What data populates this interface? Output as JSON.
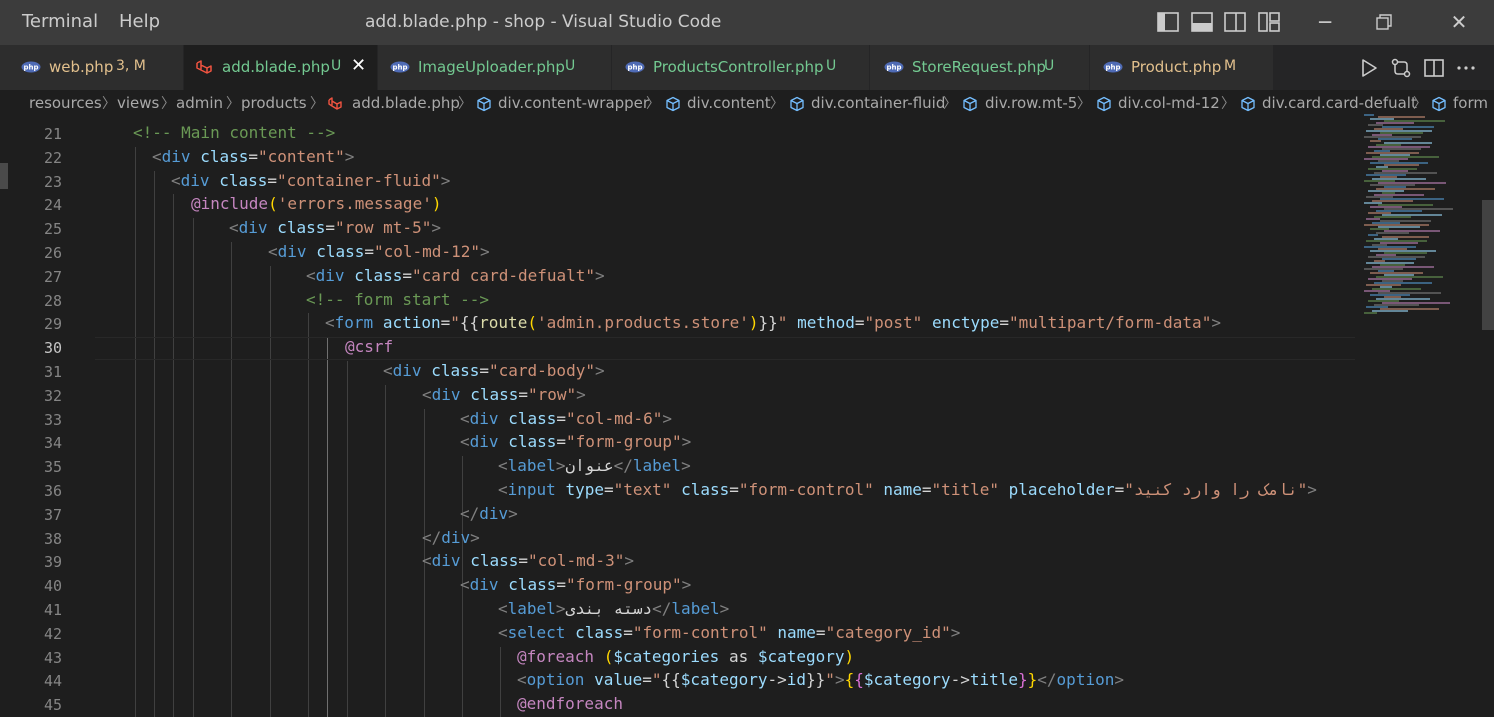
{
  "titlebar": {
    "menus": [
      "Terminal",
      "Help"
    ],
    "window_title": "add.blade.php - shop - Visual Studio Code"
  },
  "tabs": [
    {
      "icon": "php-icon",
      "name": "web.php",
      "status": "3, M",
      "name_color": "#e2c08d",
      "status_color": "#e2c08d",
      "active": false
    },
    {
      "icon": "laravel-icon",
      "name": "add.blade.php",
      "status": "U",
      "name_color": "#73c991",
      "status_color": "#73c991",
      "active": true
    },
    {
      "icon": "php-icon",
      "name": "ImageUploader.php",
      "status": "U",
      "name_color": "#73c991",
      "status_color": "#73c991",
      "active": false
    },
    {
      "icon": "php-icon",
      "name": "ProductsController.php",
      "status": "U",
      "name_color": "#73c991",
      "status_color": "#73c991",
      "active": false
    },
    {
      "icon": "php-icon",
      "name": "StoreRequest.php",
      "status": "U",
      "name_color": "#73c991",
      "status_color": "#73c991",
      "active": false
    },
    {
      "icon": "php-icon",
      "name": "Product.php",
      "status": "M",
      "name_color": "#e2c08d",
      "status_color": "#e2c08d",
      "active": false
    }
  ],
  "breadcrumbs": [
    "resources",
    "views",
    "admin",
    "products",
    "add.blade.php",
    "div.content-wrapper",
    "div.content",
    "div.container-fluid",
    "div.row.mt-5",
    "div.col-md-12",
    "div.card.card-defualt",
    "form"
  ],
  "editor": {
    "current_line": 30,
    "lines": [
      {
        "n": 21,
        "t": [
          [
            "cm",
            "<!-- Main content -->"
          ]
        ]
      },
      {
        "n": 22,
        "t": [
          [
            "pt",
            "<"
          ],
          [
            "tg",
            "div"
          ],
          [
            "tx",
            " "
          ],
          [
            "at",
            "class"
          ],
          [
            "tx",
            "="
          ],
          [
            "st",
            "\"content\""
          ],
          [
            "pt",
            ">"
          ]
        ]
      },
      {
        "n": 23,
        "t": [
          [
            "pt",
            "<"
          ],
          [
            "tg",
            "div"
          ],
          [
            "tx",
            " "
          ],
          [
            "at",
            "class"
          ],
          [
            "tx",
            "="
          ],
          [
            "st",
            "\"container-fluid\""
          ],
          [
            "pt",
            ">"
          ]
        ]
      },
      {
        "n": 24,
        "t": [
          [
            "dr",
            "@include"
          ],
          [
            "p1",
            "("
          ],
          [
            "st",
            "'errors.message'"
          ],
          [
            "p1",
            ")"
          ]
        ]
      },
      {
        "n": 25,
        "t": [
          [
            "pt",
            "<"
          ],
          [
            "tg",
            "div"
          ],
          [
            "tx",
            " "
          ],
          [
            "at",
            "class"
          ],
          [
            "tx",
            "="
          ],
          [
            "st",
            "\"row mt-5\""
          ],
          [
            "pt",
            ">"
          ]
        ]
      },
      {
        "n": 26,
        "t": [
          [
            "pt",
            "<"
          ],
          [
            "tg",
            "div"
          ],
          [
            "tx",
            " "
          ],
          [
            "at",
            "class"
          ],
          [
            "tx",
            "="
          ],
          [
            "st",
            "\"col-md-12\""
          ],
          [
            "pt",
            ">"
          ]
        ]
      },
      {
        "n": 27,
        "t": [
          [
            "pt",
            "<"
          ],
          [
            "tg",
            "div"
          ],
          [
            "tx",
            " "
          ],
          [
            "at",
            "class"
          ],
          [
            "tx",
            "="
          ],
          [
            "st",
            "\"card card-defualt\""
          ],
          [
            "pt",
            ">"
          ]
        ]
      },
      {
        "n": 28,
        "t": [
          [
            "cm",
            "<!-- form start -->"
          ]
        ]
      },
      {
        "n": 29,
        "t": [
          [
            "pt",
            "<"
          ],
          [
            "tg",
            "form"
          ],
          [
            "tx",
            " "
          ],
          [
            "at",
            "action"
          ],
          [
            "tx",
            "="
          ],
          [
            "st",
            "\""
          ],
          [
            "tx",
            "{{"
          ],
          [
            "fn",
            "route"
          ],
          [
            "p1",
            "("
          ],
          [
            "st",
            "'admin.products.store'"
          ],
          [
            "p1",
            ")"
          ],
          [
            "tx",
            "}}"
          ],
          [
            "st",
            "\""
          ],
          [
            "tx",
            " "
          ],
          [
            "at",
            "method"
          ],
          [
            "tx",
            "="
          ],
          [
            "st",
            "\"post\""
          ],
          [
            "tx",
            " "
          ],
          [
            "at",
            "enctype"
          ],
          [
            "tx",
            "="
          ],
          [
            "st",
            "\"multipart/form-data\""
          ],
          [
            "pt",
            ">"
          ]
        ]
      },
      {
        "n": 30,
        "t": [
          [
            "dr",
            "@csrf"
          ]
        ]
      },
      {
        "n": 31,
        "t": [
          [
            "pt",
            "<"
          ],
          [
            "tg",
            "div"
          ],
          [
            "tx",
            " "
          ],
          [
            "at",
            "class"
          ],
          [
            "tx",
            "="
          ],
          [
            "st",
            "\"card-body\""
          ],
          [
            "pt",
            ">"
          ]
        ]
      },
      {
        "n": 32,
        "t": [
          [
            "pt",
            "<"
          ],
          [
            "tg",
            "div"
          ],
          [
            "tx",
            " "
          ],
          [
            "at",
            "class"
          ],
          [
            "tx",
            "="
          ],
          [
            "st",
            "\"row\""
          ],
          [
            "pt",
            ">"
          ]
        ]
      },
      {
        "n": 33,
        "t": [
          [
            "pt",
            "<"
          ],
          [
            "tg",
            "div"
          ],
          [
            "tx",
            " "
          ],
          [
            "at",
            "class"
          ],
          [
            "tx",
            "="
          ],
          [
            "st",
            "\"col-md-6\""
          ],
          [
            "pt",
            ">"
          ]
        ]
      },
      {
        "n": 34,
        "t": [
          [
            "pt",
            "<"
          ],
          [
            "tg",
            "div"
          ],
          [
            "tx",
            " "
          ],
          [
            "at",
            "class"
          ],
          [
            "tx",
            "="
          ],
          [
            "st",
            "\"form-group\""
          ],
          [
            "pt",
            ">"
          ]
        ]
      },
      {
        "n": 35,
        "t": [
          [
            "pt",
            "<"
          ],
          [
            "tg",
            "label"
          ],
          [
            "pt",
            ">"
          ],
          [
            "tx",
            "عنوان"
          ],
          [
            "pt",
            "</"
          ],
          [
            "tg",
            "label"
          ],
          [
            "pt",
            ">"
          ]
        ]
      },
      {
        "n": 36,
        "t": [
          [
            "pt",
            "<"
          ],
          [
            "tg",
            "input"
          ],
          [
            "tx",
            " "
          ],
          [
            "at",
            "type"
          ],
          [
            "tx",
            "="
          ],
          [
            "st",
            "\"text\""
          ],
          [
            "tx",
            " "
          ],
          [
            "at",
            "class"
          ],
          [
            "tx",
            "="
          ],
          [
            "st",
            "\"form-control\""
          ],
          [
            "tx",
            " "
          ],
          [
            "at",
            "name"
          ],
          [
            "tx",
            "="
          ],
          [
            "st",
            "\"title\""
          ],
          [
            "tx",
            " "
          ],
          [
            "at",
            "placeholder"
          ],
          [
            "tx",
            "="
          ],
          [
            "st",
            "\"نامک را وارد کنید\""
          ],
          [
            "pt",
            ">"
          ]
        ]
      },
      {
        "n": 37,
        "t": [
          [
            "pt",
            "</"
          ],
          [
            "tg",
            "div"
          ],
          [
            "pt",
            ">"
          ]
        ]
      },
      {
        "n": 38,
        "t": [
          [
            "pt",
            "</"
          ],
          [
            "tg",
            "div"
          ],
          [
            "pt",
            ">"
          ]
        ]
      },
      {
        "n": 39,
        "t": [
          [
            "pt",
            "<"
          ],
          [
            "tg",
            "div"
          ],
          [
            "tx",
            " "
          ],
          [
            "at",
            "class"
          ],
          [
            "tx",
            "="
          ],
          [
            "st",
            "\"col-md-3\""
          ],
          [
            "pt",
            ">"
          ]
        ]
      },
      {
        "n": 40,
        "t": [
          [
            "pt",
            "<"
          ],
          [
            "tg",
            "div"
          ],
          [
            "tx",
            " "
          ],
          [
            "at",
            "class"
          ],
          [
            "tx",
            "="
          ],
          [
            "st",
            "\"form-group\""
          ],
          [
            "pt",
            ">"
          ]
        ]
      },
      {
        "n": 41,
        "t": [
          [
            "pt",
            "<"
          ],
          [
            "tg",
            "label"
          ],
          [
            "pt",
            ">"
          ],
          [
            "tx",
            "دسته بندی"
          ],
          [
            "pt",
            "</"
          ],
          [
            "tg",
            "label"
          ],
          [
            "pt",
            ">"
          ]
        ]
      },
      {
        "n": 42,
        "t": [
          [
            "pt",
            "<"
          ],
          [
            "tg",
            "select"
          ],
          [
            "tx",
            " "
          ],
          [
            "at",
            "class"
          ],
          [
            "tx",
            "="
          ],
          [
            "st",
            "\"form-control\""
          ],
          [
            "tx",
            " "
          ],
          [
            "at",
            "name"
          ],
          [
            "tx",
            "="
          ],
          [
            "st",
            "\"category_id\""
          ],
          [
            "pt",
            ">"
          ]
        ]
      },
      {
        "n": 43,
        "t": [
          [
            "dr",
            "@foreach"
          ],
          [
            "tx",
            " "
          ],
          [
            "p1",
            "("
          ],
          [
            "vr",
            "$categories"
          ],
          [
            "tx",
            " as "
          ],
          [
            "vr",
            "$category"
          ],
          [
            "p1",
            ")"
          ]
        ]
      },
      {
        "n": 44,
        "t": [
          [
            "pt",
            "<"
          ],
          [
            "tg",
            "option"
          ],
          [
            "tx",
            " "
          ],
          [
            "at",
            "value"
          ],
          [
            "tx",
            "="
          ],
          [
            "st",
            "\""
          ],
          [
            "tx",
            "{{"
          ],
          [
            "vr",
            "$category"
          ],
          [
            "tx",
            "->"
          ],
          [
            "vr",
            "id"
          ],
          [
            "tx",
            "}}"
          ],
          [
            "st",
            "\""
          ],
          [
            "pt",
            ">"
          ],
          [
            "p1",
            "{"
          ],
          [
            "p2",
            "{"
          ],
          [
            "vr",
            "$category"
          ],
          [
            "tx",
            "->"
          ],
          [
            "vr",
            "title"
          ],
          [
            "p2",
            "}"
          ],
          [
            "p1",
            "}"
          ],
          [
            "pt",
            "</"
          ],
          [
            "tg",
            "option"
          ],
          [
            "pt",
            ">"
          ]
        ]
      },
      {
        "n": 45,
        "t": [
          [
            "dr",
            "@endforeach"
          ]
        ]
      }
    ]
  }
}
